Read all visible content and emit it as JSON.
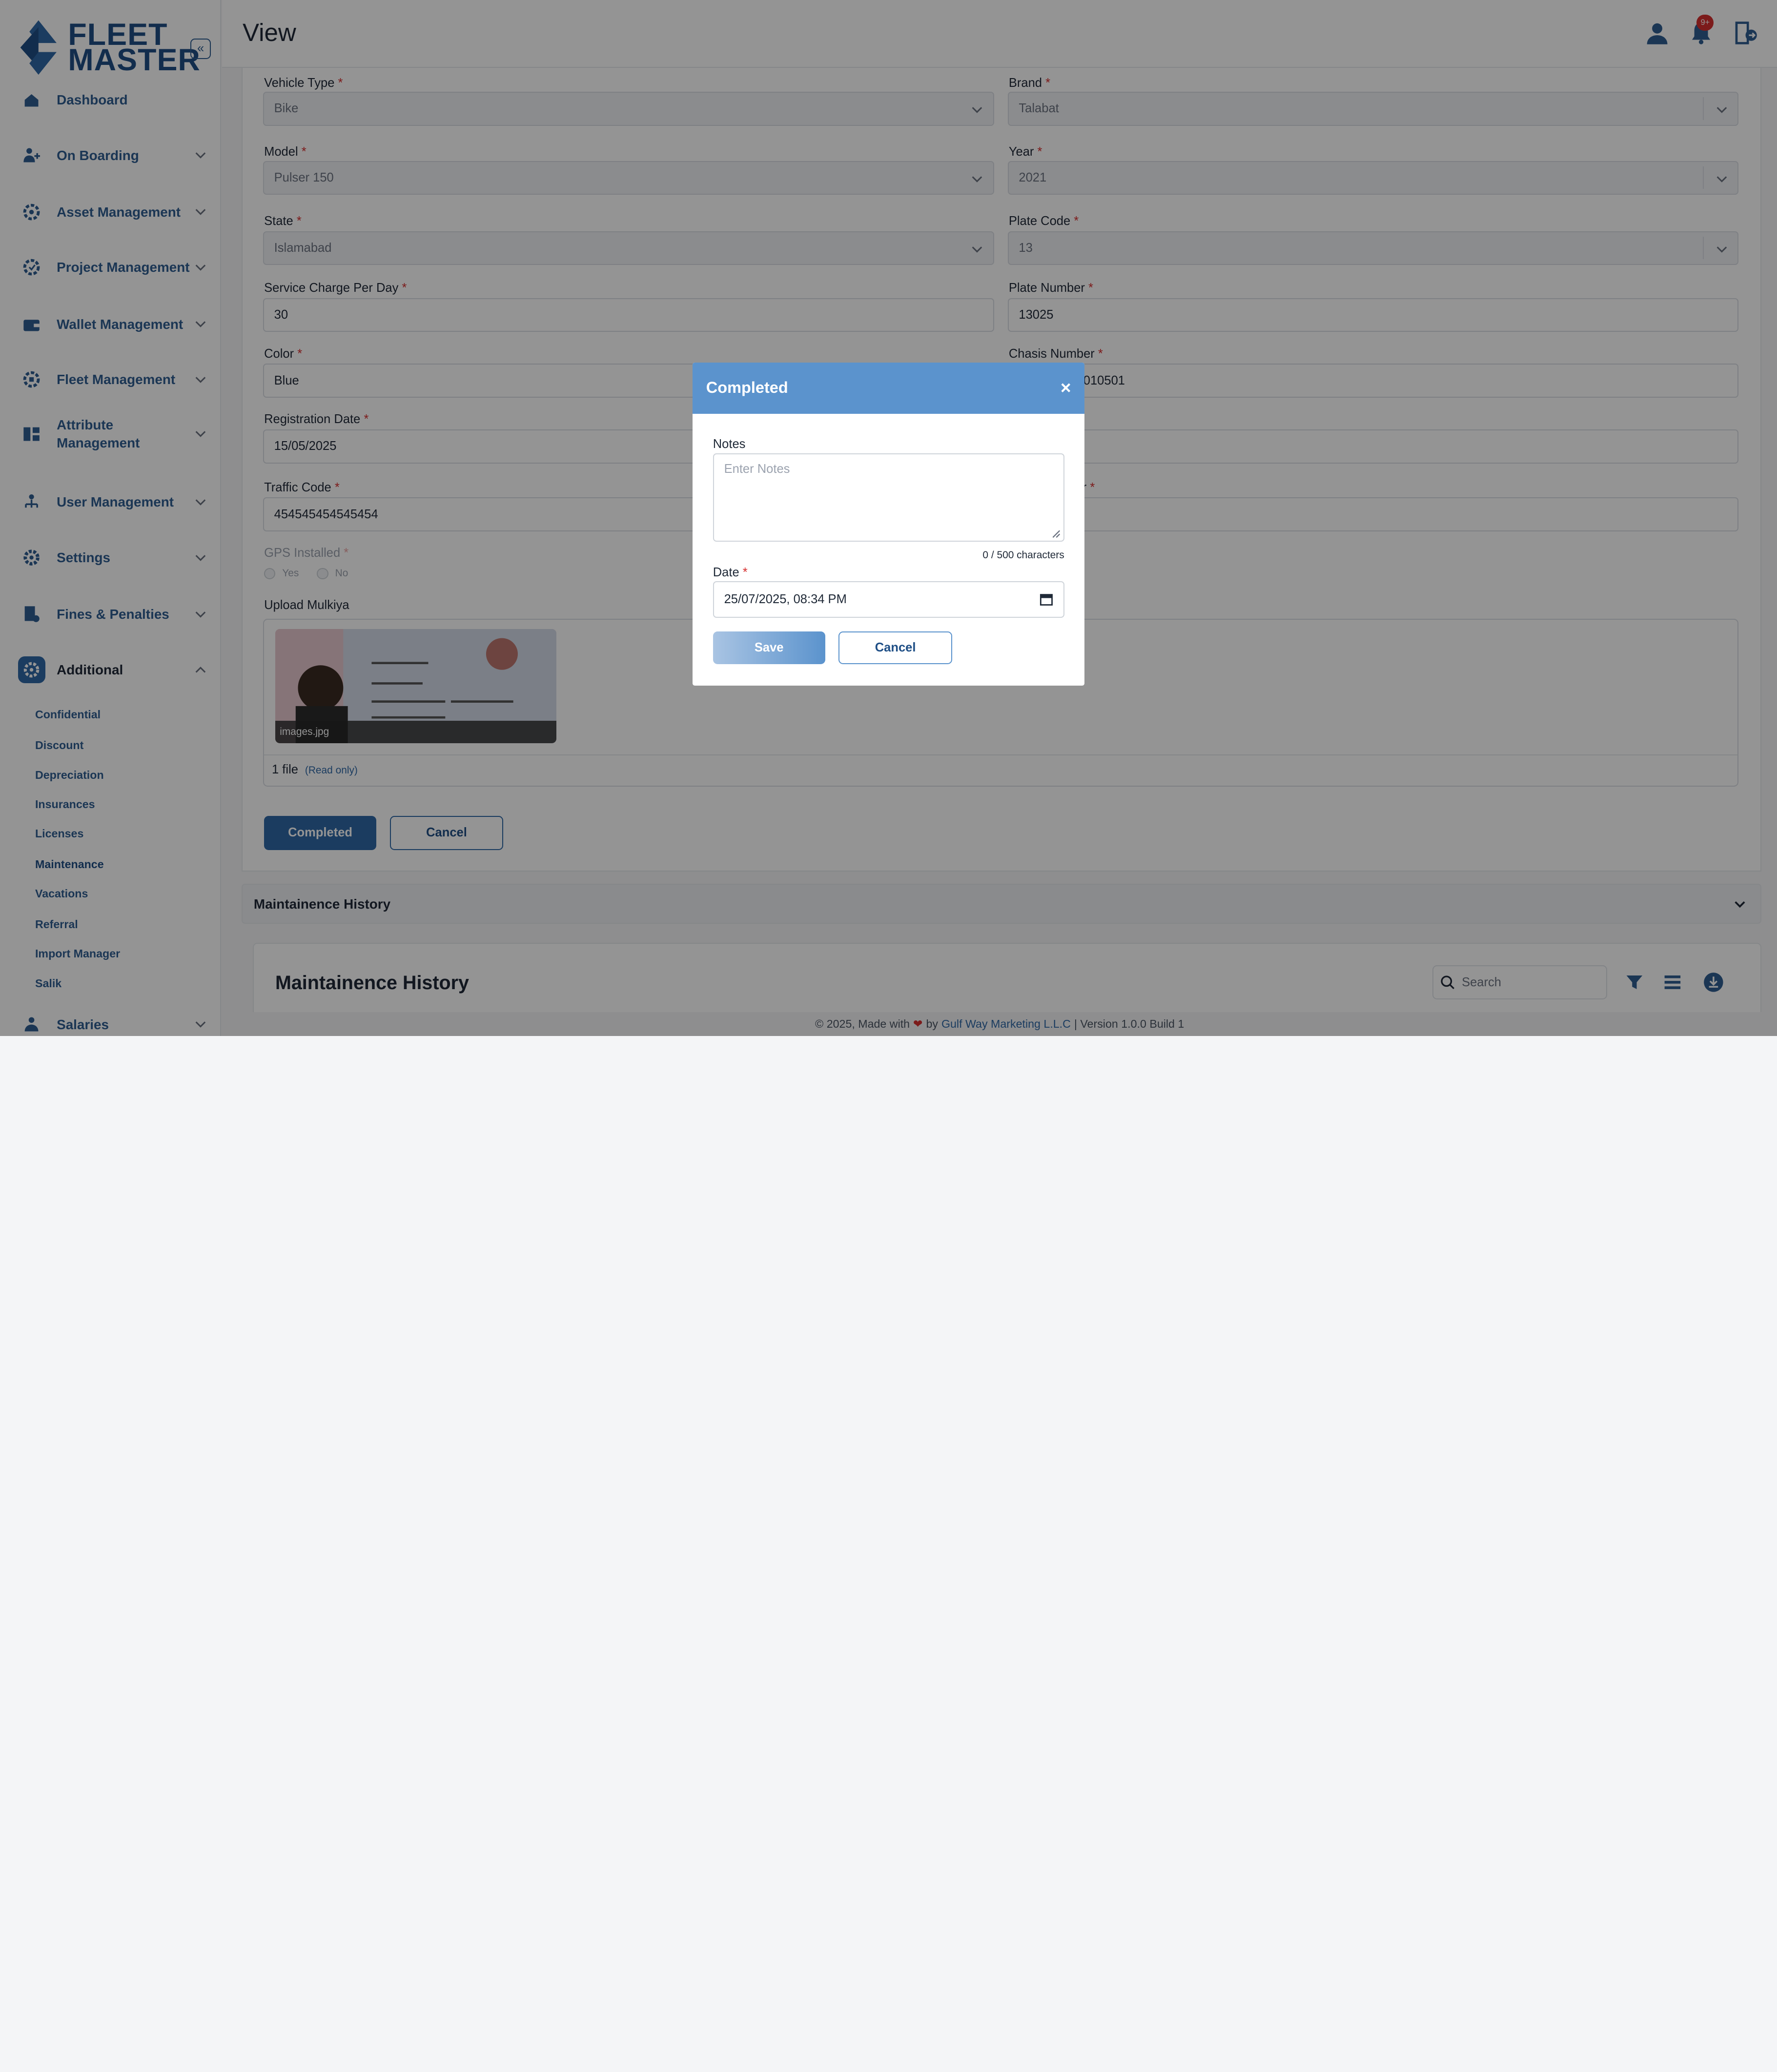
{
  "app": {
    "logo_line1": "FLEET",
    "logo_line2": "MASTER",
    "collapse_glyph": "«",
    "page_title": "View",
    "notifications_badge": "9+"
  },
  "sidebar": {
    "items": [
      {
        "label": "Dashboard",
        "icon": "home-icon"
      },
      {
        "label": "On Boarding",
        "icon": "user-plus-icon"
      },
      {
        "label": "Asset Management",
        "icon": "gear-asset-icon"
      },
      {
        "label": "Project Management",
        "icon": "gear-project-icon"
      },
      {
        "label": "Wallet Management",
        "icon": "wallet-icon"
      },
      {
        "label": "Fleet Management",
        "icon": "fleet-icon"
      },
      {
        "label": "Attribute Management",
        "icon": "attribute-icon"
      },
      {
        "label": "User Management",
        "icon": "users-icon"
      },
      {
        "label": "Settings",
        "icon": "settings-icon"
      },
      {
        "label": "Fines & Penalties",
        "icon": "fines-icon"
      },
      {
        "label": "Additional",
        "icon": "additional-icon"
      },
      {
        "label": "Salaries",
        "icon": "salaries-icon"
      }
    ],
    "additional_sub_items": [
      "Confidential",
      "Discount",
      "Depreciation",
      "Insurances",
      "Licenses",
      "Maintenance",
      "Vacations",
      "Referral",
      "Import Manager",
      "Salik"
    ]
  },
  "form": {
    "vehicle_type": {
      "label": "Vehicle Type",
      "value": "Bike"
    },
    "brand": {
      "label": "Brand",
      "value": "Talabat"
    },
    "model": {
      "label": "Model",
      "value": "Pulser 150"
    },
    "year": {
      "label": "Year",
      "value": "2021"
    },
    "state": {
      "label": "State",
      "value": "Islamabad"
    },
    "plate_code": {
      "label": "Plate Code",
      "value": "13"
    },
    "service_charge": {
      "label": "Service Charge Per Day",
      "value": "30"
    },
    "plate_number": {
      "label": "Plate Number",
      "value": "13025"
    },
    "color": {
      "label": "Color",
      "value": "Blue"
    },
    "chasis_number": {
      "label": "Chasis Number",
      "value": "010501"
    },
    "registration_date": {
      "label": "Registration Date",
      "value": "15/05/2025"
    },
    "traffic_code": {
      "label": "Traffic Code",
      "value": "454545454545454"
    },
    "partial_label_r": "r",
    "gps_installed": {
      "label": "GPS Installed",
      "yes": "Yes",
      "no": "No"
    },
    "upload": {
      "label": "Upload Mulkiya",
      "file_name": "images.jpg",
      "file_count": "1 file",
      "read_only": "(Read only)"
    },
    "completed_button": "Completed",
    "cancel_button": "Cancel"
  },
  "history": {
    "accordion_title": "Maintainence History",
    "card_title": "Maintainence History",
    "search_placeholder": "Search"
  },
  "footer": {
    "prefix": "© 2025, Made with",
    "by": "by",
    "company": "Gulf Way Marketing L.L.C",
    "version": "| Version 1.0.0 Build 1"
  },
  "modal": {
    "title": "Completed",
    "close_glyph": "×",
    "notes_label": "Notes",
    "notes_placeholder": "Enter Notes",
    "char_count": "0 / 500 characters",
    "date_label": "Date",
    "date_value": "25/07/2025, 08:34 PM",
    "save_label": "Save",
    "cancel_label": "Cancel"
  },
  "colors": {
    "brand": "#1f4f86",
    "accent": "#2f68a6",
    "modal_header": "#5b93cd",
    "required": "#d62f2f"
  }
}
